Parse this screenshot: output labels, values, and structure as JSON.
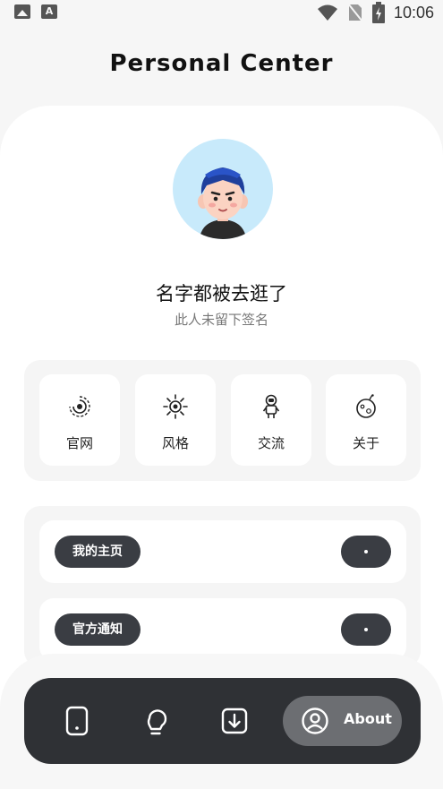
{
  "status_bar": {
    "time": "10:06"
  },
  "header": {
    "title": "Personal Center"
  },
  "profile": {
    "name": "名字都被去逛了",
    "signature": "此人未留下签名"
  },
  "shortcuts": [
    {
      "label": "官网",
      "icon": "spiral-galaxy-icon"
    },
    {
      "label": "风格",
      "icon": "sun-eye-icon"
    },
    {
      "label": "交流",
      "icon": "astronaut-icon"
    },
    {
      "label": "关于",
      "icon": "planet-icon"
    }
  ],
  "list": [
    {
      "label": "我的主页"
    },
    {
      "label": "官方通知"
    }
  ],
  "bottom_nav": {
    "items": [
      "phone-icon",
      "lightbulb-icon",
      "download-icon"
    ],
    "active": {
      "label": "About",
      "icon": "user-circle-icon"
    }
  },
  "colors": {
    "dark": "#3a3d43",
    "avatar_bg": "#c8eafb",
    "navbar": "#2f3135"
  }
}
